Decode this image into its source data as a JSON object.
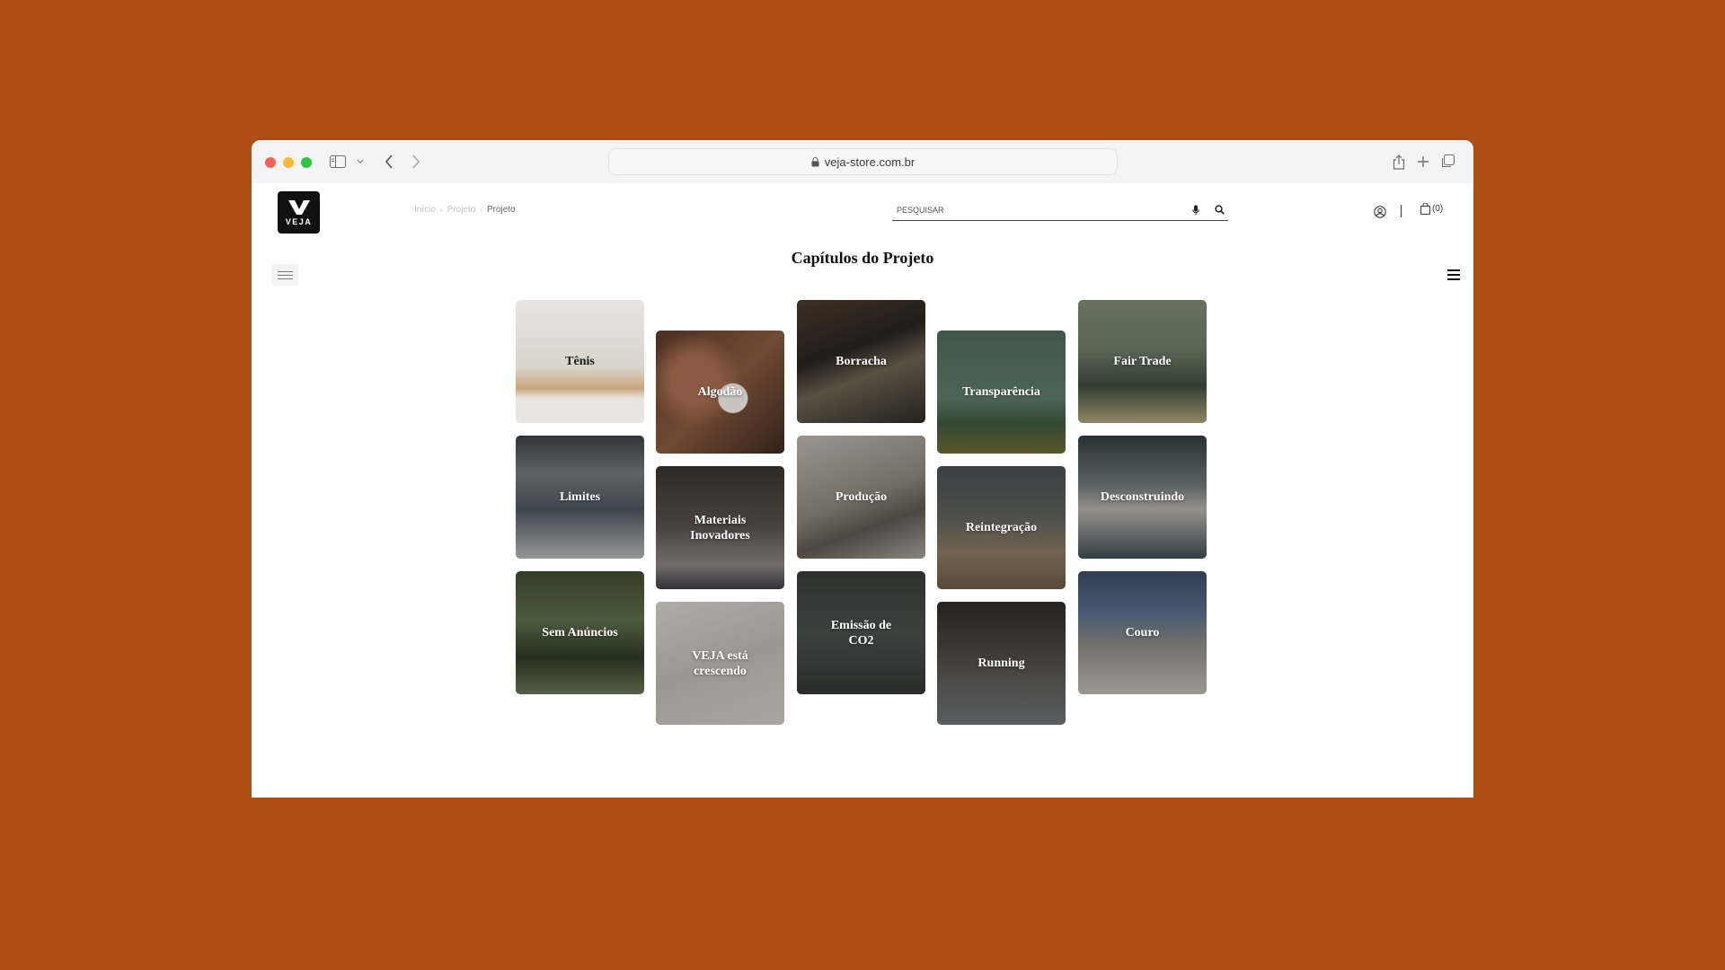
{
  "browser": {
    "url": "veja-store.com.br"
  },
  "header": {
    "logo_text": "VEJA",
    "breadcrumb": [
      "Início",
      "Projeto",
      "Projeto"
    ],
    "breadcrumb_sep": "›",
    "search_placeholder": "PESQUISAR",
    "cart_count": "(0)"
  },
  "main": {
    "title": "Capítulos do Projeto",
    "tiles": [
      {
        "label": "Tênis"
      },
      {
        "label": "Algodão"
      },
      {
        "label": "Borracha"
      },
      {
        "label": "Transparência"
      },
      {
        "label": "Fair Trade"
      },
      {
        "label": "Limites"
      },
      {
        "label": "Materiais Inovadores"
      },
      {
        "label": "Produção"
      },
      {
        "label": "Reintegração"
      },
      {
        "label": "Desconstruindo"
      },
      {
        "label": "Sem Anúncios"
      },
      {
        "label": "VEJA está crescendo"
      },
      {
        "label": "Emissão de CO2"
      },
      {
        "label": "Running"
      },
      {
        "label": "Couro"
      }
    ]
  },
  "colors": {
    "background": "#ae4e14",
    "logo_bg": "#111111"
  }
}
